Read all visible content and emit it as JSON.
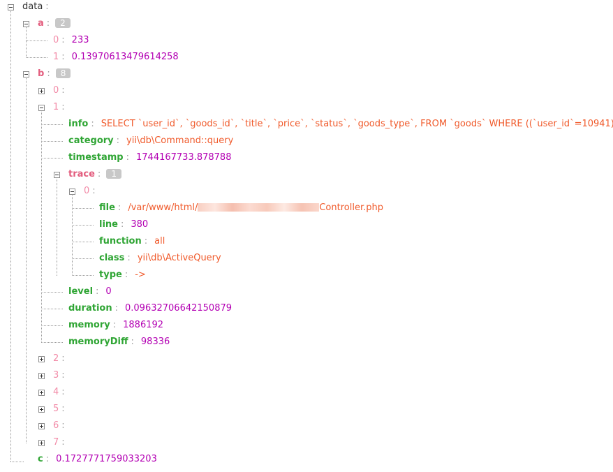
{
  "root_key": "data",
  "a": {
    "key": "a",
    "count": "2",
    "items": [
      {
        "index": "0",
        "value": "233"
      },
      {
        "index": "1",
        "value": "0.13970613479614258"
      }
    ]
  },
  "b": {
    "key": "b",
    "count": "8",
    "index_0": "0",
    "index_1": "1",
    "info_key": "info",
    "info_value": "SELECT `user_id`, `goods_id`, `title`, `price`, `status`, `goods_type`, FROM `goods` WHERE ((`user_id`=10941)",
    "category_key": "category",
    "category_value": "yii\\db\\Command::query",
    "timestamp_key": "timestamp",
    "timestamp_value": "1744167733.878788",
    "trace_key": "trace",
    "trace_count": "1",
    "trace_index": "0",
    "file_key": "file",
    "file_prefix": "/var/www/html/",
    "file_suffix": "Controller.php",
    "line_key": "line",
    "line_value": "380",
    "function_key": "function",
    "function_value": "all",
    "class_key": "class",
    "class_value": "yii\\db\\ActiveQuery",
    "type_key": "type",
    "type_value": "->",
    "level_key": "level",
    "level_value": "0",
    "duration_key": "duration",
    "duration_value": "0.09632706642150879",
    "memory_key": "memory",
    "memory_value": "1886192",
    "memorydiff_key": "memoryDiff",
    "memorydiff_value": "98336",
    "collapsed_indices": [
      "2",
      "3",
      "4",
      "5",
      "6",
      "7"
    ]
  },
  "c": {
    "key": "c",
    "value": "0.1727771759033203"
  },
  "colon": ":",
  "colors": {
    "key": "#2fa534",
    "object_key": "#e35d7e",
    "index": "#f28aa7",
    "number": "#b300b3",
    "string": "#f05a2b",
    "badge": "#c8c8c8"
  }
}
